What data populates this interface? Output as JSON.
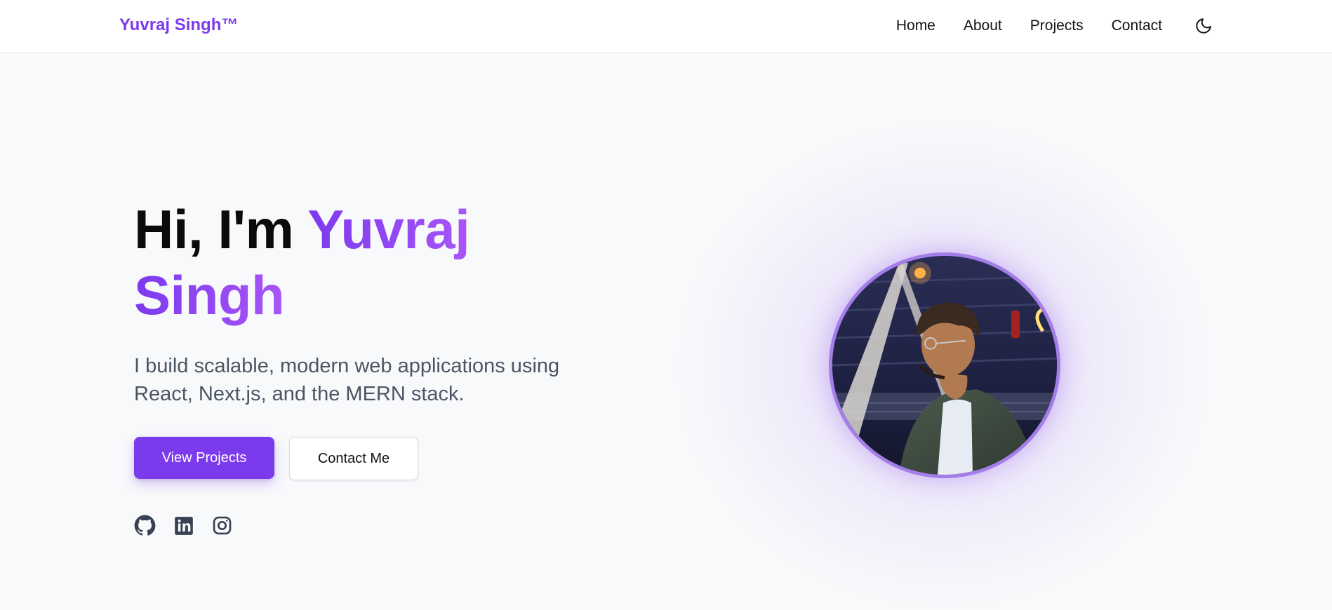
{
  "nav": {
    "brand": "Yuvraj Singh™",
    "links": [
      {
        "label": "Home"
      },
      {
        "label": "About"
      },
      {
        "label": "Projects"
      },
      {
        "label": "Contact"
      }
    ],
    "theme_icon": "moon-icon"
  },
  "hero": {
    "greeting": "Hi, I'm ",
    "name_first": "Yuvraj",
    "name_last": "Singh",
    "subtitle": "I build scalable, modern web applications using React, Next.js, and the MERN stack.",
    "primary_button": "View Projects",
    "secondary_button": "Contact Me",
    "socials": [
      {
        "icon": "github-icon"
      },
      {
        "icon": "linkedin-icon"
      },
      {
        "icon": "instagram-icon"
      }
    ]
  },
  "colors": {
    "accent": "#7c3aed",
    "accent_light": "#a855f7",
    "subtitle": "#4b5563",
    "background": "#f8f9fb"
  }
}
